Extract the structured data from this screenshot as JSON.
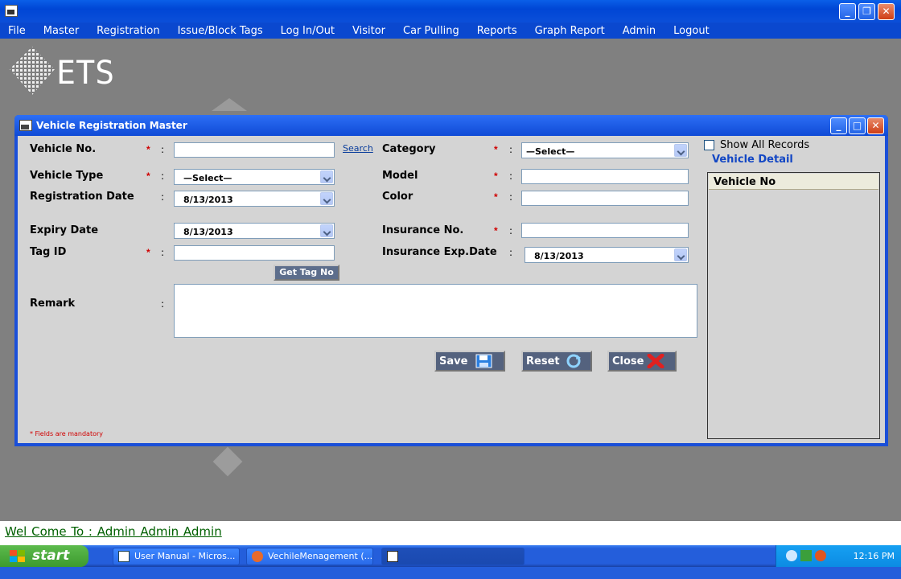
{
  "window": {
    "menu": [
      "File",
      "Master",
      "Registration",
      "Issue/Block Tags",
      "Log In/Out",
      "Visitor",
      "Car Pulling",
      "Reports",
      "Graph Report",
      "Admin",
      "Logout"
    ],
    "logo_text": "ETS"
  },
  "dialog": {
    "title": "Vehicle Registration Master",
    "fields": {
      "vehicle_no": {
        "label": "Vehicle No.",
        "value": ""
      },
      "vehicle_type": {
        "label": "Vehicle Type",
        "value": "—Select—"
      },
      "registration_date": {
        "label": "Registration Date",
        "value": "8/13/2013"
      },
      "expiry_date": {
        "label": "Expiry Date",
        "value": "8/13/2013"
      },
      "tag_id": {
        "label": "Tag ID",
        "value": ""
      },
      "remark": {
        "label": "Remark",
        "value": ""
      },
      "category": {
        "label": "Category",
        "value": "—Select—"
      },
      "model": {
        "label": "Model",
        "value": ""
      },
      "color": {
        "label": "Color",
        "value": ""
      },
      "insurance_no": {
        "label": "Insurance No.",
        "value": ""
      },
      "insurance_exp_date": {
        "label": "Insurance Exp.Date",
        "value": "8/13/2013"
      }
    },
    "search_link": "Search",
    "get_tag_button": "Get Tag No",
    "buttons": {
      "save": "Save",
      "reset": "Reset",
      "close": "Close"
    },
    "mandatory_note": "* Fields are mandatory",
    "colon": ":",
    "star": "*",
    "right_panel": {
      "show_all_label": "Show All Records",
      "detail_title": "Vehicle Detail",
      "column_header": "Vehicle No"
    }
  },
  "status": {
    "welcome": "Wel Come To : Admin   Admin   Admin"
  },
  "taskbar": {
    "start_label": "start",
    "items": [
      "User Manual - Micros...",
      "VechileMenagement (..."
    ],
    "clock": "12:16 PM"
  },
  "colors": {
    "xp_blue": "#0a48cf",
    "mandatory_red": "#d00000",
    "welcome_green": "#006000"
  }
}
